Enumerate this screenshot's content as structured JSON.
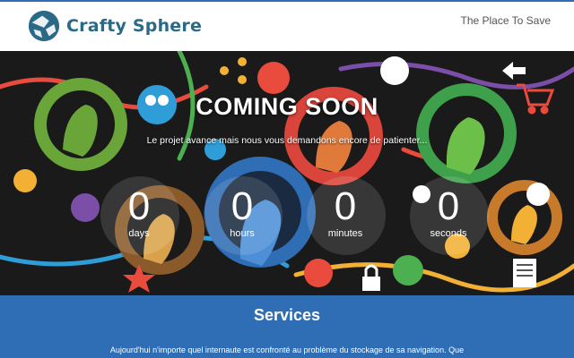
{
  "header": {
    "brand": "Crafty Sphere",
    "tagline": "The Place To Save"
  },
  "hero": {
    "title": "COMING SOON",
    "subtitle": "Le projet avance mais nous vous demandons encore de patienter...",
    "countdown": [
      {
        "value": "0",
        "label": "days"
      },
      {
        "value": "0",
        "label": "hours"
      },
      {
        "value": "0",
        "label": "minutes"
      },
      {
        "value": "0",
        "label": "seconds"
      }
    ]
  },
  "services": {
    "title": "Services",
    "text": "Aujourd'hui n'importe quel internaute est confronté au problème du stockage de sa navigation. Que"
  },
  "colors": {
    "accent_blue": "#2f6db4",
    "brand_teal": "#2b6a86",
    "hero_bg": "#1a1a1a"
  },
  "icons": [
    "logo-sphere-icon",
    "gear-icon",
    "person-icon",
    "cart-icon",
    "arrow-icon",
    "star-icon",
    "paperclip-icon",
    "lock-icon",
    "mail-icon"
  ]
}
